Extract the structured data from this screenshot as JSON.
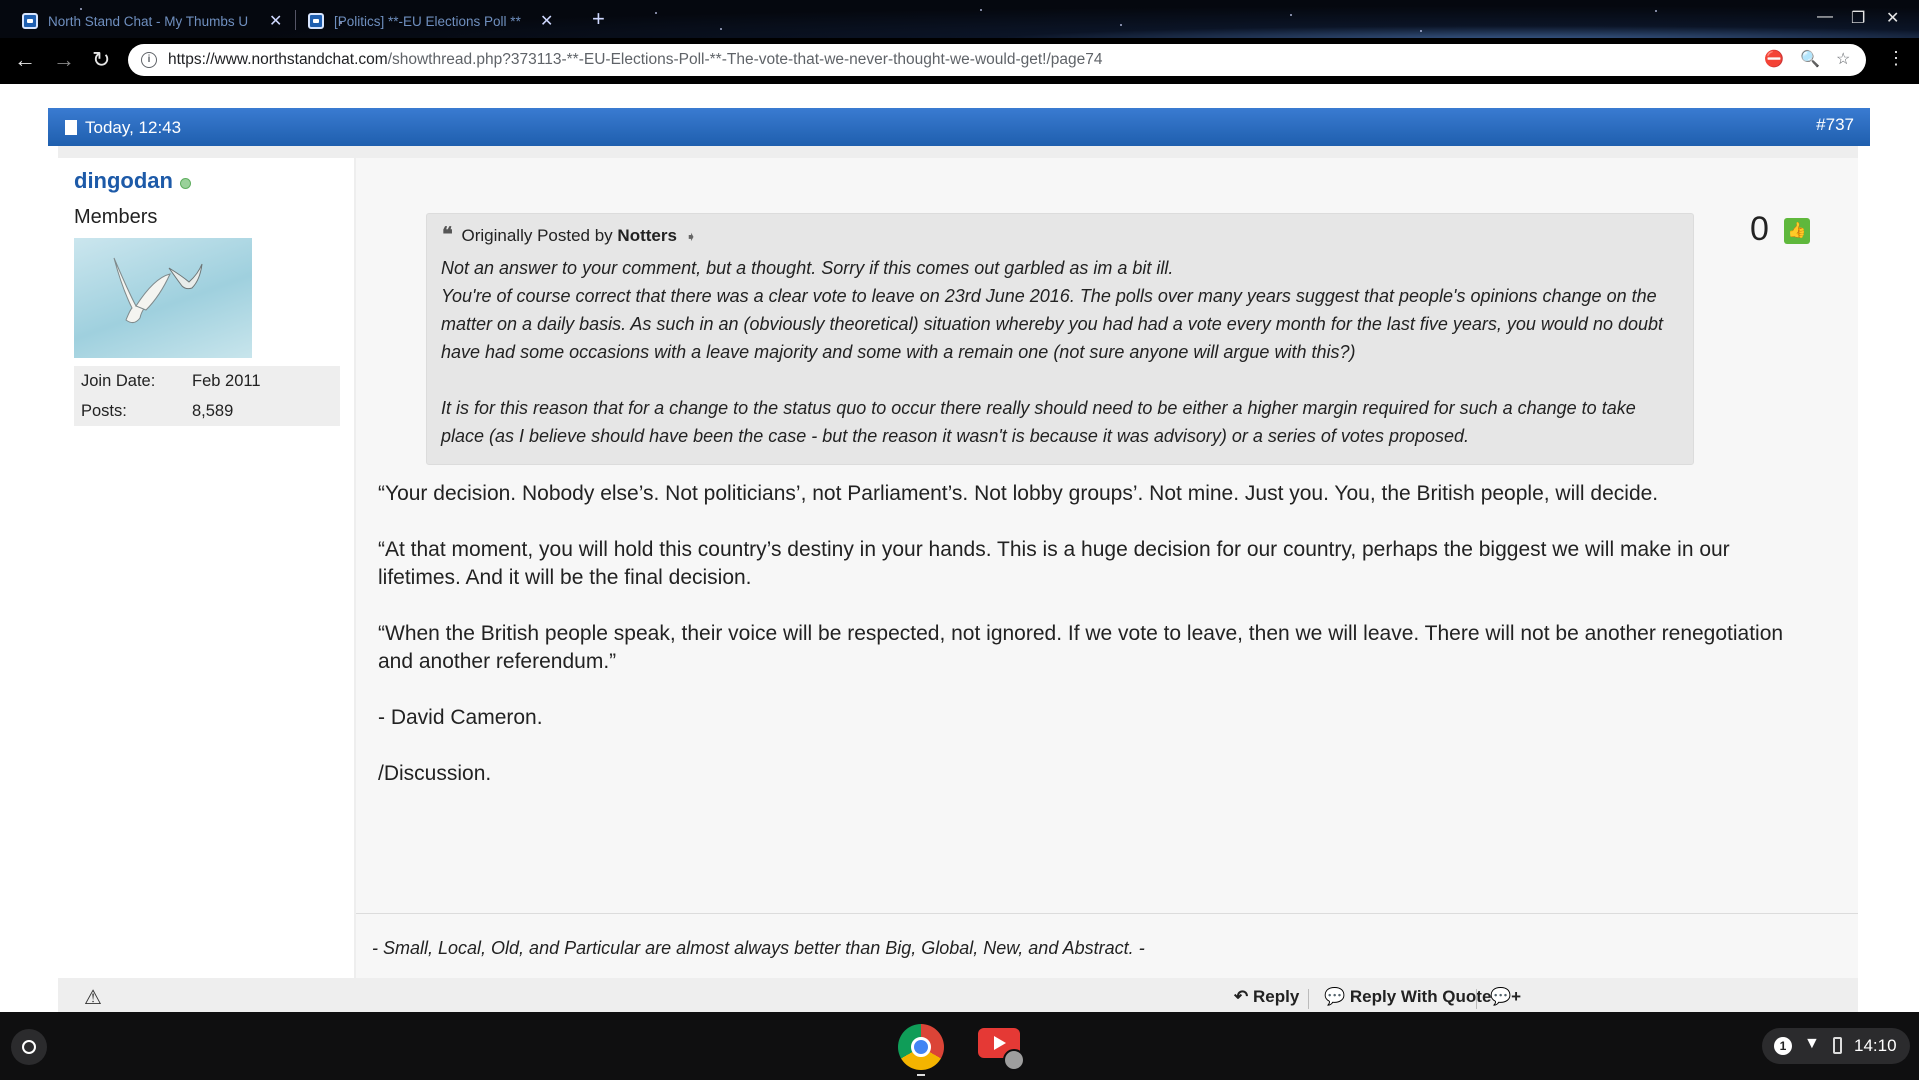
{
  "browser": {
    "tabs": [
      {
        "title": "North Stand Chat - My Thumbs U",
        "active": false
      },
      {
        "title": "[Politics] **-EU Elections Poll **",
        "active": true
      }
    ],
    "url_domain": "https://www.northstandchat.com",
    "url_path": "/showthread.php?373113-**-EU-Elections-Poll-**-The-vote-that-we-never-thought-we-would-get!/page74"
  },
  "post": {
    "date": "Today, 12:43",
    "number": "#737",
    "user": {
      "name": "dingodan",
      "title": "Members",
      "stats": [
        {
          "label": "Join Date:",
          "value": "Feb 2011"
        },
        {
          "label": "Posts:",
          "value": "8,589"
        }
      ]
    },
    "vote_count": "0",
    "quote": {
      "prefix": "Originally Posted by",
      "author": "Notters",
      "paragraphs": [
        "Not an answer to your comment, but a thought. Sorry if this comes out garbled as im a bit ill.\nYou're of course correct that there was a clear vote to leave on 23rd June 2016. The polls over many years suggest that people's opinions change on the matter on a daily basis. As such in an (obviously theoretical) situation whereby you had had a vote every month for the last five years, you would no doubt have had some occasions with a leave majority and some with a remain one (not sure anyone will argue with this?)",
        "It is for this reason that for a change to the status quo to occur there really should need to be either a higher margin required for such a change to take place (as I believe should have been the case - but the reason it wasn't is because it was advisory) or a series of votes proposed."
      ]
    },
    "message": [
      "“Your decision. Nobody else’s. Not politicians’, not Parliament’s. Not lobby groups’. Not mine. Just you. You, the British people, will decide.",
      "“At that moment, you will hold this country’s destiny in your hands. This is a huge decision for our country, perhaps the biggest we will make in our lifetimes. And it will be the final decision.",
      "“When the British people speak, their voice will be respected, not ignored. If we vote to leave, then we will leave. There will not be another renegotiation and another referendum.”",
      "- David Cameron.",
      "/Discussion."
    ],
    "signature": "- Small, Local, Old, and Particular are almost always better than Big, Global, New, and Abstract. -",
    "footer": {
      "reply": "Reply",
      "reply_with_quote": "Reply With Quote"
    }
  },
  "shelf": {
    "time": "14:10",
    "notification_count": "1"
  },
  "colors": {
    "header_blue": "#1f5fae",
    "username_blue": "#1d5aa8",
    "vote_green": "#5fb83c"
  }
}
